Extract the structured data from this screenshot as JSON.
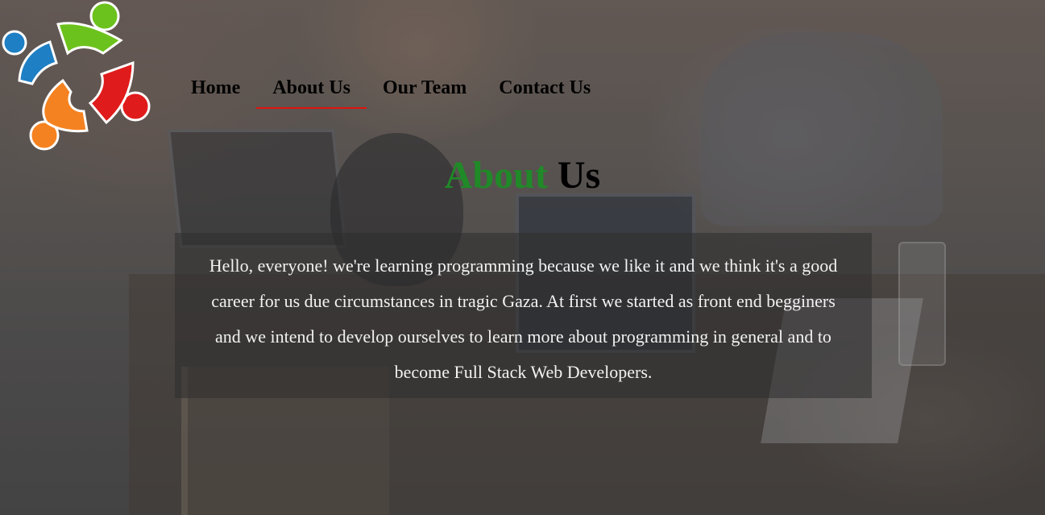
{
  "nav": {
    "items": [
      {
        "label": "Home",
        "active": false
      },
      {
        "label": "About Us",
        "active": true
      },
      {
        "label": "Our Team",
        "active": false
      },
      {
        "label": "Contact Us",
        "active": false
      }
    ]
  },
  "heading": {
    "accent": "About",
    "rest": "Us"
  },
  "about": {
    "text": "Hello, everyone! we're learning programming because we like it and we think it's a good career for us due circumstances in tragic Gaza. At first we started as front end begginers and we intend to develop ourselves to learn more about programming in general and to become Full Stack Web Developers."
  },
  "colors": {
    "accent_green": "#1f8a27",
    "active_underline": "#e0130e",
    "logo_blue": "#1e7fc4",
    "logo_green": "#6cc21c",
    "logo_red": "#e01b1b",
    "logo_orange": "#f58220"
  },
  "icons": {
    "logo": "team-circle-logo"
  }
}
